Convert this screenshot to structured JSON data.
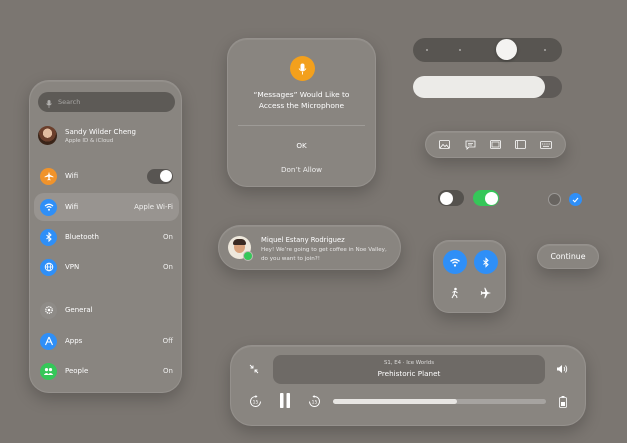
{
  "settings": {
    "search_placeholder": "Search",
    "account": {
      "name": "Sandy Wilder Cheng",
      "subtitle": "Apple ID & iCloud"
    },
    "rows": [
      {
        "label": "Wifi",
        "value": "",
        "icon": "airplane-icon",
        "color": "#f0932b"
      },
      {
        "label": "Wifi",
        "value": "Apple Wi-Fi",
        "icon": "wifi-icon",
        "color": "#2f8ff7"
      },
      {
        "label": "Bluetooth",
        "value": "On",
        "icon": "bluetooth-icon",
        "color": "#2f8ff7"
      },
      {
        "label": "VPN",
        "value": "On",
        "icon": "vpn-icon",
        "color": "#2f8ff7"
      },
      {
        "label": "General",
        "value": "",
        "icon": "gear-icon",
        "color": "#8e8b87"
      },
      {
        "label": "Apps",
        "value": "Off",
        "icon": "apps-icon",
        "color": "#2f8ff7"
      },
      {
        "label": "People",
        "value": "On",
        "icon": "people-icon",
        "color": "#35c759"
      }
    ]
  },
  "alert": {
    "title_line1": "“Messages” Would Like to",
    "title_line2": "Access the Microphone",
    "ok_label": "OK",
    "deny_label": "Don’t Allow",
    "icon": "microphone-icon",
    "accent": "#f3a01c"
  },
  "sliders": {
    "brightness_level": 0.62,
    "volume_level": 0.89
  },
  "toolbar": {
    "icons": [
      "photo-icon",
      "message-bubble-icon",
      "window-icon",
      "split-view-icon",
      "keyboard-icon"
    ]
  },
  "toggles": {
    "toggle_1_on": false,
    "toggle_2_on": true,
    "accent": "#35c759",
    "radio_selected": "#2f8ff7"
  },
  "notification": {
    "sender": "Miquel Estany Rodriguez",
    "message": "Hey! We’re going to get coffee in Noe Valley, do you want to join?!"
  },
  "continue_label": "Continue",
  "player": {
    "episode": "S1, E4 · Ice Worlds",
    "show": "Prehistoric Planet",
    "progress": 0.58
  }
}
